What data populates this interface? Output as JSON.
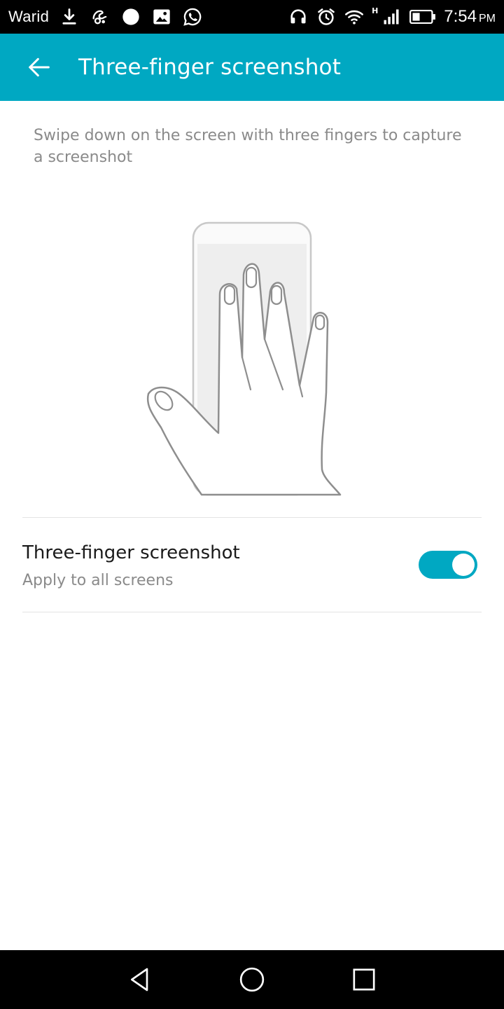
{
  "status_bar": {
    "carrier": "Warid",
    "time": "7:54",
    "ampm": "PM",
    "network_type": "H",
    "left_icons": [
      "download-icon",
      "uc-browser-icon",
      "circle-notification-icon",
      "image-icon",
      "whatsapp-icon"
    ],
    "right_icons": [
      "headset-icon",
      "alarm-icon",
      "wifi-icon",
      "signal-icon",
      "battery-icon"
    ]
  },
  "app_bar": {
    "title": "Three-finger screenshot",
    "back_icon": "arrow-left-icon"
  },
  "content": {
    "description": "Swipe down on the screen with three fingers to capture a screenshot",
    "illustration": "hand-swipe-illustration"
  },
  "setting": {
    "title": "Three-finger screenshot",
    "summary": "Apply to all screens",
    "enabled": true
  },
  "nav_bar": {
    "buttons": [
      "back-triangle-icon",
      "home-circle-icon",
      "recents-square-icon"
    ]
  },
  "colors": {
    "accent": "#00a8c2",
    "status_bar": "#000000",
    "nav_bar": "#000000",
    "secondary_text": "#8a8a8a",
    "primary_text": "#1a1a1a"
  }
}
